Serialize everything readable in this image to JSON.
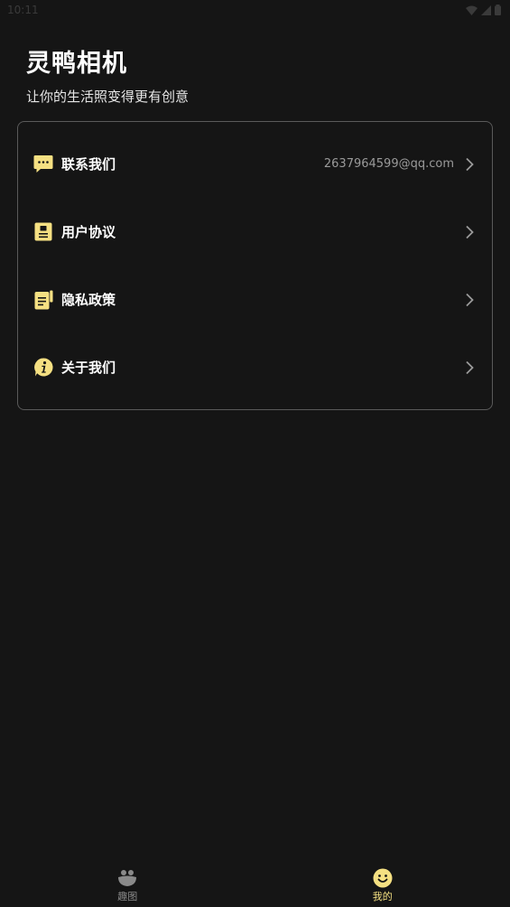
{
  "status_bar": {
    "time": "10:11"
  },
  "header": {
    "title": "灵鸭相机",
    "subtitle": "让你的生活照变得更有创意"
  },
  "menu": {
    "items": [
      {
        "label": "联系我们",
        "value": "2637964599@qq.com",
        "icon": "message-icon"
      },
      {
        "label": "用户协议",
        "value": "",
        "icon": "document-icon"
      },
      {
        "label": "隐私政策",
        "value": "",
        "icon": "policy-icon"
      },
      {
        "label": "关于我们",
        "value": "",
        "icon": "info-icon"
      }
    ]
  },
  "tab_bar": {
    "tabs": [
      {
        "label": "趣图",
        "icon": "fun-pics-icon",
        "active": false
      },
      {
        "label": "我的",
        "icon": "smiley-icon",
        "active": true
      }
    ]
  },
  "colors": {
    "background": "#151515",
    "accent": "#f5e082",
    "border": "#5a5a5a",
    "secondary_text": "#9a9a9a"
  }
}
